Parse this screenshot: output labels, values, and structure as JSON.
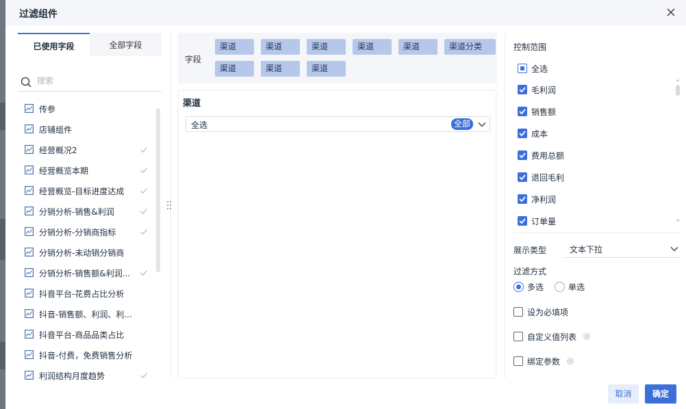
{
  "dialog": {
    "title": "过滤组件"
  },
  "left_panel": {
    "tabs": [
      {
        "label": "已使用字段",
        "active": true
      },
      {
        "label": "全部字段",
        "active": false
      }
    ],
    "search_placeholder": "搜索",
    "fields": [
      {
        "label": "传参",
        "used": false
      },
      {
        "label": "店铺组件",
        "used": false
      },
      {
        "label": "经营概况2",
        "used": true
      },
      {
        "label": "经营概览本期",
        "used": true
      },
      {
        "label": "经营概览-目标进度达成",
        "used": true
      },
      {
        "label": "分销分析-销售&利润",
        "used": true
      },
      {
        "label": "分销分析-分销商指标",
        "used": true
      },
      {
        "label": "分销分析-未动销分销商",
        "used": false
      },
      {
        "label": "分销分析-销售额&利润...",
        "used": true
      },
      {
        "label": "抖音平台-花费占比分析",
        "used": false
      },
      {
        "label": "抖音-销售额、利润、利...",
        "used": false
      },
      {
        "label": "抖音平台-商品品类占比",
        "used": false
      },
      {
        "label": "抖音-付费，免费销售分析",
        "used": false
      },
      {
        "label": "利润结构月度趋势",
        "used": true
      }
    ]
  },
  "field_bar": {
    "label": "字段",
    "chips": [
      "渠道",
      "渠道",
      "渠道",
      "渠道",
      "渠道",
      "渠道分类",
      "渠道",
      "渠道",
      "渠道"
    ]
  },
  "filter": {
    "title": "渠道",
    "select_value": "全选",
    "badge": "全部"
  },
  "right_panel": {
    "control_scope_label": "控制范围",
    "scope_items": [
      {
        "label": "全选",
        "state": "partial"
      },
      {
        "label": "毛利润",
        "state": "checked"
      },
      {
        "label": "销售额",
        "state": "checked"
      },
      {
        "label": "成本",
        "state": "checked"
      },
      {
        "label": "费用总额",
        "state": "checked"
      },
      {
        "label": "退回毛利",
        "state": "checked"
      },
      {
        "label": "净利润",
        "state": "checked"
      },
      {
        "label": "订单量",
        "state": "checked"
      }
    ],
    "display_type_label": "展示类型",
    "display_type_value": "文本下拉",
    "filter_mode_label": "过滤方式",
    "filter_modes": [
      {
        "label": "多选",
        "selected": true
      },
      {
        "label": "单选",
        "selected": false
      }
    ],
    "options": [
      {
        "label": "设为必填项",
        "checked": false,
        "has_gear": false
      },
      {
        "label": "自定义值列表",
        "checked": false,
        "has_gear": true
      },
      {
        "label": "绑定参数",
        "checked": false,
        "has_gear": true
      }
    ]
  },
  "footer": {
    "cancel_label": "取消",
    "ok_label": "确定"
  },
  "colors": {
    "primary": "#3c6fd8",
    "chip": "#b6c8ea",
    "panel_bg": "#f4f6f9"
  }
}
